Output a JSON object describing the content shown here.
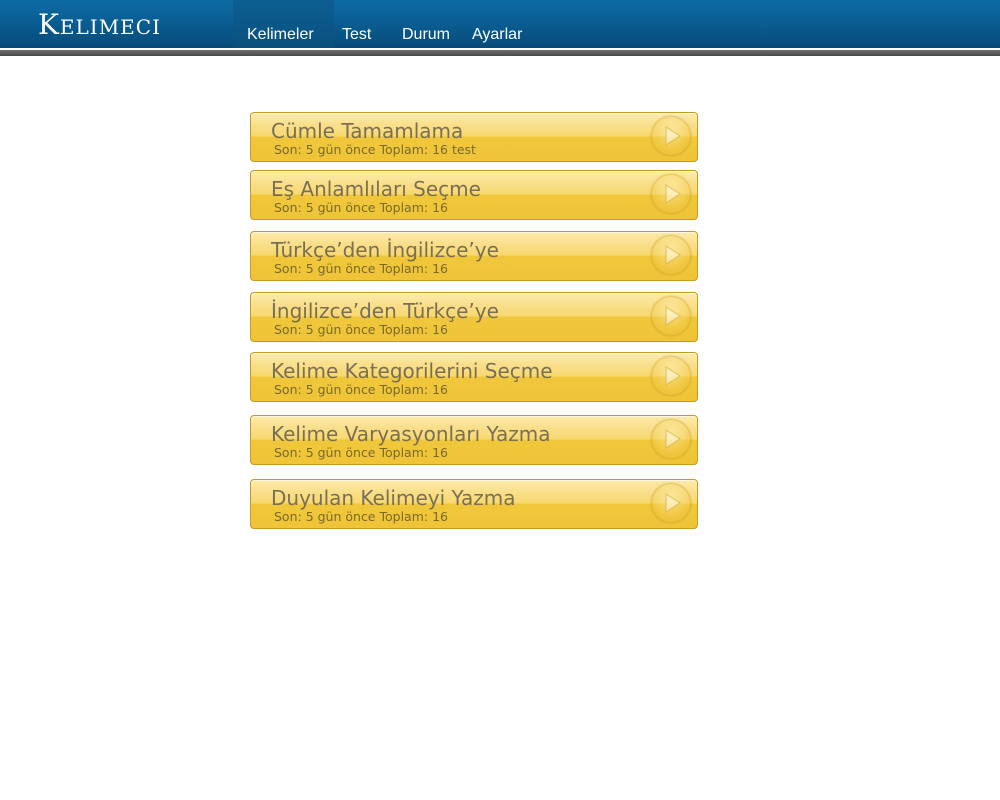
{
  "app": {
    "logo": "Kelimeci"
  },
  "nav": {
    "items": [
      {
        "label": "Kelimeler",
        "active": true
      },
      {
        "label": "Test"
      },
      {
        "label": "Durum"
      },
      {
        "label": "Ayarlar"
      }
    ]
  },
  "exercises": [
    {
      "title": "Cümle Tamamlama",
      "subtitle": "Son: 5 gün önce Toplam: 16 test"
    },
    {
      "title": "Eş Anlamlıları Seçme",
      "subtitle": "Son: 5 gün önce Toplam: 16"
    },
    {
      "title": "Türkçe’den İngilizce’ye",
      "subtitle": "Son: 5 gün önce Toplam: 16"
    },
    {
      "title": "İngilizce’den Türkçe’ye",
      "subtitle": "Son: 5 gün önce Toplam: 16"
    },
    {
      "title": "Kelime Kategorilerini Seçme",
      "subtitle": "Son: 5 gün önce Toplam: 16"
    },
    {
      "title": "Kelime Varyasyonları Yazma",
      "subtitle": "Son: 5 gün önce Toplam: 16"
    },
    {
      "title": "Duyulan Kelimeyi Yazma",
      "subtitle": "Son: 5 gün önce Toplam: 16"
    }
  ],
  "icons": {
    "play": "play-icon"
  },
  "colors": {
    "header": "#0a5e93",
    "card": "#f0c73b",
    "card_border": "#c99a20"
  }
}
